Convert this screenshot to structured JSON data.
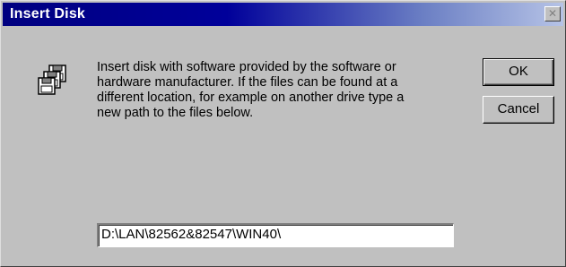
{
  "window": {
    "title": "Insert Disk",
    "close_glyph": "✕"
  },
  "dialog": {
    "icon": "floppy-disks-icon",
    "message": "Insert disk with software provided by the software or\nhardware manufacturer.  If the files can be found at a\ndifferent location, for example on another drive type a\nnew path to the files below.",
    "ok_label": "OK",
    "cancel_label": "Cancel",
    "path_value": "D:\\LAN\\82562&82547\\WIN40\\"
  },
  "colors": {
    "titlebar_start": "#000080",
    "titlebar_end": "#b6c3e6",
    "face": "#c0c0c0"
  }
}
